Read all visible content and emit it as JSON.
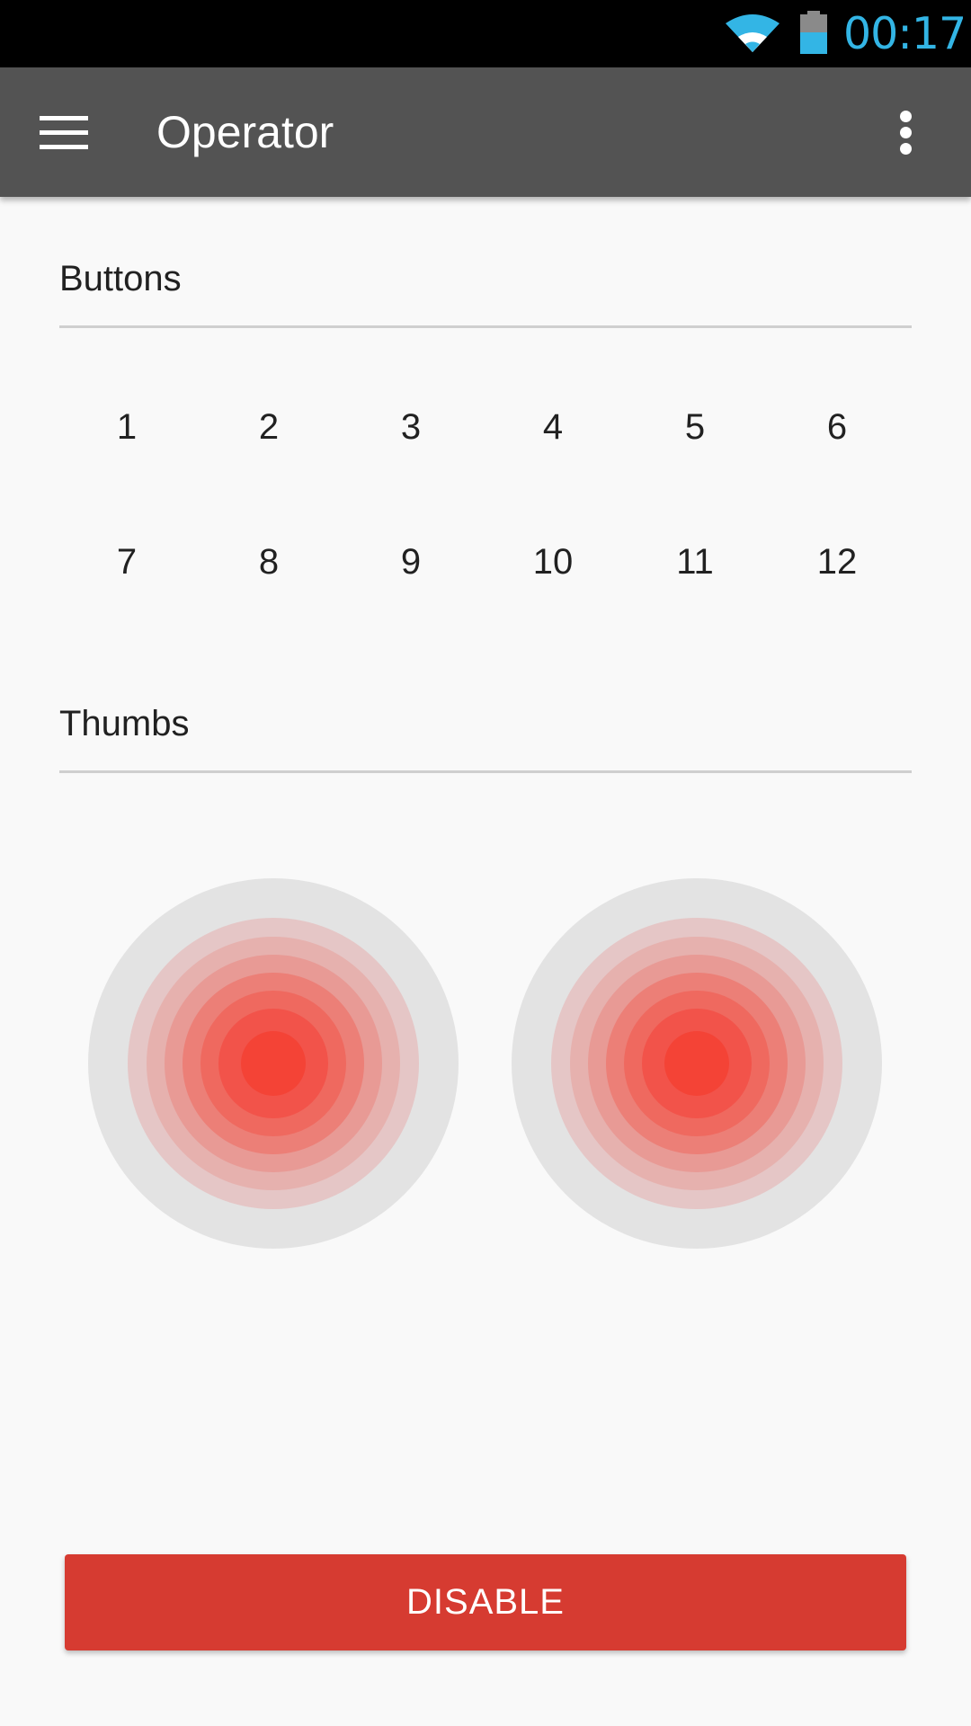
{
  "status_bar": {
    "time": "00:17",
    "wifi_icon": "wifi-icon",
    "battery_icon": "battery-icon",
    "time_color": "#33b5e5"
  },
  "toolbar": {
    "title": "Operator",
    "menu_icon": "hamburger-menu-icon",
    "overflow_icon": "overflow-menu-icon",
    "background": "#535353"
  },
  "buttons_section": {
    "title": "Buttons",
    "items": [
      "1",
      "2",
      "3",
      "4",
      "5",
      "6",
      "7",
      "8",
      "9",
      "10",
      "11",
      "12"
    ]
  },
  "thumbs_section": {
    "title": "Thumbs",
    "thumbs": [
      {
        "name": "left-thumb"
      },
      {
        "name": "right-thumb"
      }
    ],
    "accent_color": "#f44336"
  },
  "disable_button": {
    "label": "DISABLE",
    "color": "#d63b31"
  }
}
